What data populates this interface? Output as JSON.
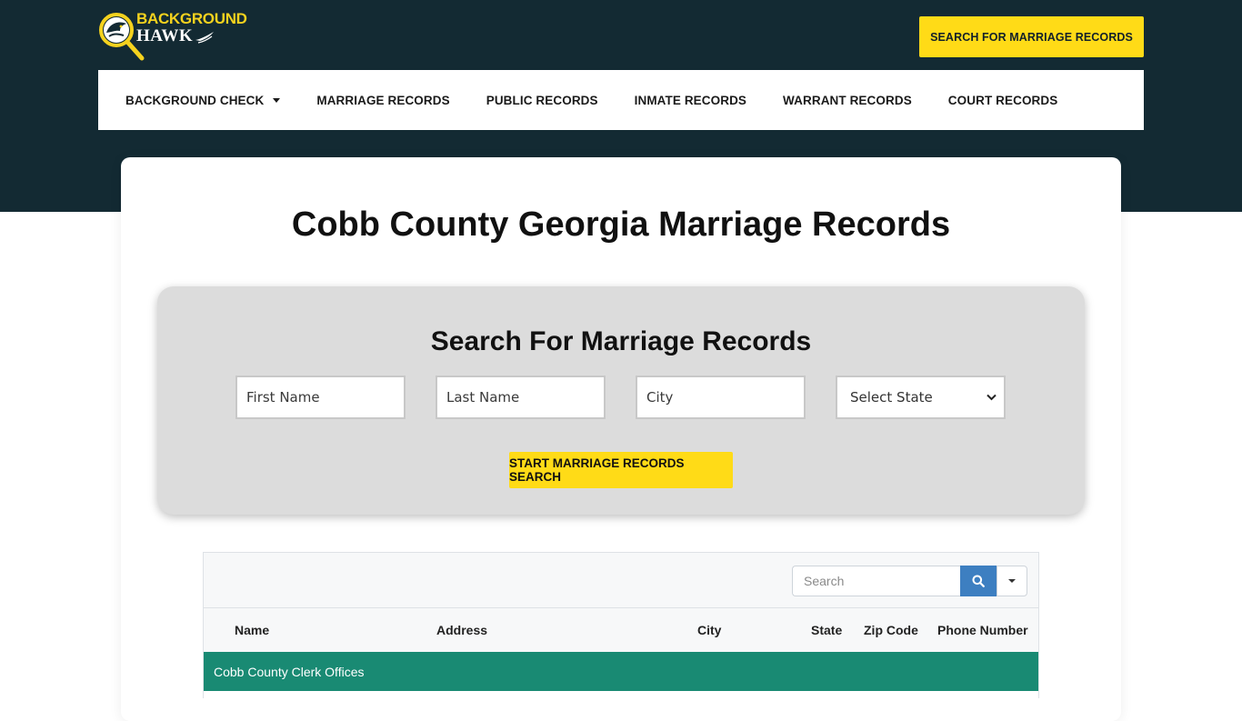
{
  "logo": {
    "line1": "BACKGROUND",
    "line2": "HAWK"
  },
  "header": {
    "cta_label": "SEARCH FOR MARRIAGE RECORDS"
  },
  "nav": {
    "items": [
      {
        "label": "BACKGROUND CHECK",
        "has_dropdown": true
      },
      {
        "label": "MARRIAGE RECORDS"
      },
      {
        "label": "PUBLIC RECORDS"
      },
      {
        "label": "INMATE RECORDS"
      },
      {
        "label": "WARRANT RECORDS"
      },
      {
        "label": "COURT RECORDS"
      }
    ]
  },
  "main": {
    "title": "Cobb County Georgia Marriage Records"
  },
  "search": {
    "title": "Search For Marriage Records",
    "first_name_placeholder": "First Name",
    "last_name_placeholder": "Last Name",
    "city_placeholder": "City",
    "state_selected": "Select State",
    "button_label": "START MARRIAGE RECORDS SEARCH"
  },
  "table": {
    "search_placeholder": "Search",
    "columns": [
      "Name",
      "Address",
      "City",
      "State",
      "Zip Code",
      "Phone Number"
    ],
    "group_label": "Cobb County Clerk Offices"
  },
  "colors": {
    "header_bg": "#132a33",
    "accent_yellow": "#ffdb17",
    "group_row_green": "#198a73",
    "search_button_blue": "#3d7fc1"
  }
}
